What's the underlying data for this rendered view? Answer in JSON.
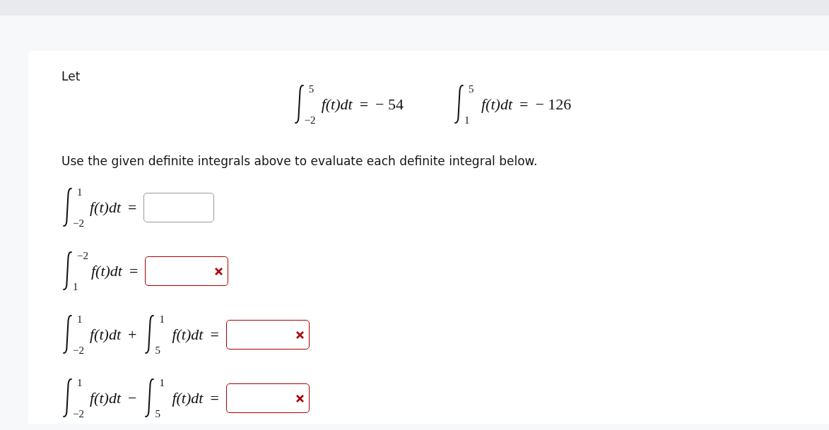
{
  "intro": "Let",
  "given": [
    {
      "lower": "−2",
      "upper": "5",
      "integrand": "f(t)dt",
      "equals": "=",
      "value": "− 54"
    },
    {
      "lower": "1",
      "upper": "5",
      "integrand": "f(t)dt",
      "equals": "=",
      "value": "− 126"
    }
  ],
  "instruction": "Use the given definite integrals above to evaluate each definite integral below.",
  "problems": [
    {
      "terms": [
        {
          "lower": "−2",
          "upper": "1",
          "integrand": "f(t)dt"
        }
      ],
      "equals": "=",
      "incorrect": false
    },
    {
      "terms": [
        {
          "lower": "1",
          "upper": "−2",
          "integrand": "f(t)dt"
        }
      ],
      "equals": "=",
      "incorrect": true
    },
    {
      "terms": [
        {
          "lower": "−2",
          "upper": "1",
          "integrand": "f(t)dt",
          "operator": "+"
        },
        {
          "lower": "5",
          "upper": "1",
          "integrand": "f(t)dt"
        }
      ],
      "equals": "=",
      "incorrect": true
    },
    {
      "terms": [
        {
          "lower": "−2",
          "upper": "1",
          "integrand": "f(t)dt",
          "operator": "−"
        },
        {
          "lower": "5",
          "upper": "1",
          "integrand": "f(t)dt"
        }
      ],
      "equals": "=",
      "incorrect": true
    }
  ]
}
